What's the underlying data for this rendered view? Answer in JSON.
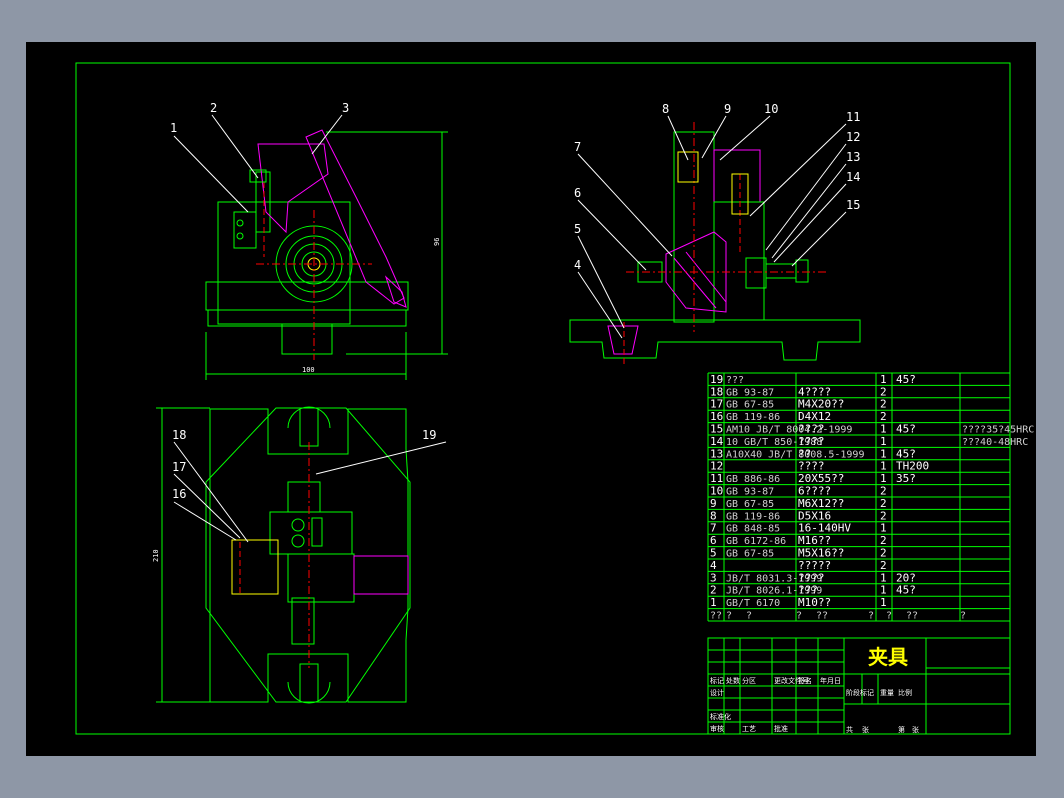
{
  "title_block": {
    "name": "夹具",
    "labels": [
      "标记",
      "处数",
      "分区",
      "更改文件号",
      "签名",
      "年月日",
      "设计",
      "标准化",
      "审核",
      "工艺",
      "批准",
      "阶段标记",
      "重量",
      "比例",
      "共",
      "张",
      "第",
      "张"
    ]
  },
  "bom_header": [
    "??",
    "?",
    "?",
    "?",
    "??",
    "?",
    "?",
    "??",
    "?"
  ],
  "bom": [
    {
      "no": "19",
      "code": "???",
      "name": "",
      "qty": "1",
      "mat": "45?",
      "note": ""
    },
    {
      "no": "18",
      "code": "GB 93-87",
      "name": "4????",
      "qty": "2",
      "mat": "",
      "note": ""
    },
    {
      "no": "17",
      "code": "GB 67-85",
      "name": "M4X20??",
      "qty": "2",
      "mat": "",
      "note": ""
    },
    {
      "no": "16",
      "code": "GB 119-86",
      "name": "D4X12",
      "qty": "2",
      "mat": "",
      "note": ""
    },
    {
      "no": "15",
      "code": "AM10 JB/T 8004.2-1999",
      "name": "????",
      "qty": "1",
      "mat": "45?",
      "note": "????35?45HRC"
    },
    {
      "no": "14",
      "code": "10 GB/T 850-1988",
      "name": "????",
      "qty": "1",
      "mat": "",
      "note": "???40-48HRC"
    },
    {
      "no": "13",
      "code": "A10X40 JB/T 8008.5-1999",
      "name": "??",
      "qty": "1",
      "mat": "45?",
      "note": ""
    },
    {
      "no": "12",
      "code": "",
      "name": "????",
      "qty": "1",
      "mat": "TH200",
      "note": ""
    },
    {
      "no": "11",
      "code": "GB 886-86",
      "name": "20X55??",
      "qty": "1",
      "mat": "35?",
      "note": ""
    },
    {
      "no": "10",
      "code": "GB 93-87",
      "name": "6????",
      "qty": "2",
      "mat": "",
      "note": ""
    },
    {
      "no": "9",
      "code": "GB 67-85",
      "name": "M6X12??",
      "qty": "2",
      "mat": "",
      "note": ""
    },
    {
      "no": "8",
      "code": "GB 119-86",
      "name": "D5X16",
      "qty": "2",
      "mat": "",
      "note": ""
    },
    {
      "no": "7",
      "code": "GB 848-85",
      "name": "16-140HV",
      "qty": "1",
      "mat": "",
      "note": ""
    },
    {
      "no": "6",
      "code": "GB 6172-86",
      "name": "M16??",
      "qty": "2",
      "mat": "",
      "note": ""
    },
    {
      "no": "5",
      "code": "GB 67-85",
      "name": "M5X16??",
      "qty": "2",
      "mat": "",
      "note": ""
    },
    {
      "no": "4",
      "code": "",
      "name": "?????",
      "qty": "2",
      "mat": "",
      "note": ""
    },
    {
      "no": "3",
      "code": "JB/T 8031.3-1999",
      "name": "????",
      "qty": "1",
      "mat": "20?",
      "note": ""
    },
    {
      "no": "2",
      "code": "JB/T 8026.1-1999",
      "name": "???",
      "qty": "1",
      "mat": "45?",
      "note": ""
    },
    {
      "no": "1",
      "code": "GB/T 6170",
      "name": "M10??",
      "qty": "1",
      "mat": "",
      "note": ""
    }
  ],
  "view1_callouts": [
    "1",
    "2",
    "3"
  ],
  "view2_callouts": [
    "4",
    "5",
    "6",
    "7",
    "8",
    "9",
    "10",
    "11",
    "12",
    "13",
    "14",
    "15"
  ],
  "view3_callouts": [
    "16",
    "17",
    "18",
    "19"
  ],
  "dims": {
    "v1_height": "96",
    "v1_width": "100",
    "v3_height": "210"
  },
  "colors": {
    "frame": "#00ff00",
    "part": "#ff00ff",
    "center": "#ff0000",
    "text": "#ffffff",
    "title": "#ffff00",
    "cyan": "#00ffff",
    "yellow": "#ffff00"
  }
}
